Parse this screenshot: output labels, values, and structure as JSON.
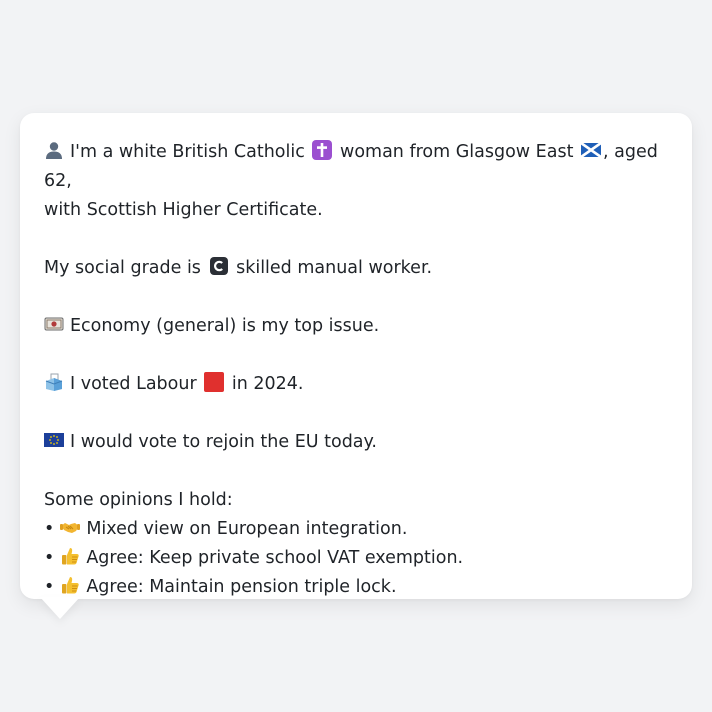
{
  "profile": {
    "intro_a": "I'm a white British Catholic",
    "intro_b": "woman from Glasgow East",
    "intro_c": ", aged 62,",
    "intro_line2": "with Scottish Higher Certificate.",
    "grade_a": "My social grade is",
    "grade_b": "skilled manual worker.",
    "top_issue": "Economy (general) is my top issue.",
    "vote_a": "I voted Labour",
    "vote_b": "in 2024.",
    "eu": "I would vote to rejoin the EU today.",
    "opinions_heading": "Some opinions I hold:",
    "opinions": [
      {
        "bullet": "•",
        "icon": "handshake-icon",
        "text": "Mixed view on European integration."
      },
      {
        "bullet": "•",
        "icon": "thumbs-up-icon",
        "text": "Agree: Keep private school VAT exemption."
      },
      {
        "bullet": "•",
        "icon": "thumbs-up-icon",
        "text": "Agree: Maintain pension triple lock."
      }
    ]
  },
  "icons": {
    "person": "person-silhouette-icon",
    "cross": "latin-cross-icon",
    "scotland_flag": "scotland-flag-icon",
    "grade": "circled-c-icon",
    "money": "money-icon",
    "ballot": "ballot-box-icon",
    "labour": "red-square-icon",
    "eu_flag": "eu-flag-icon"
  },
  "colors": {
    "background": "#f2f3f5",
    "bubble": "#ffffff",
    "text": "#1f2328",
    "labour_red": "#e0302e",
    "cross_purple": "#9b4fd0",
    "scotland_blue": "#1f5fb8",
    "eu_blue": "#1c3f9a"
  }
}
